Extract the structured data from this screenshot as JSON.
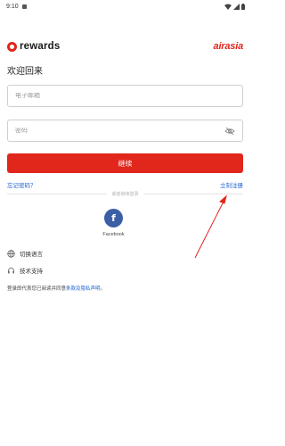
{
  "status_bar": {
    "time": "9:10"
  },
  "header": {
    "brand": "rewards",
    "airline_logo": "airasia"
  },
  "welcome_title": "欢迎回来",
  "email": {
    "placeholder": "电子邮箱",
    "value": ""
  },
  "password": {
    "placeholder": "密码",
    "value": ""
  },
  "continue_label": "继续",
  "forgot_password": "忘记密码？",
  "signup": "立刻注册",
  "divider_text": "或者继续登录",
  "facebook": {
    "label": "Facebook",
    "icon": "facebook-icon"
  },
  "menu": {
    "language": "切换语言",
    "support": "技术支持"
  },
  "terms": {
    "prefix": "登录即代表您已阅读并同意",
    "link": "条款及隐私声明",
    "suffix": "。"
  },
  "colors": {
    "brand_red": "#e1261c",
    "link_blue": "#1a5fd1",
    "facebook_blue": "#3b5fa6"
  }
}
